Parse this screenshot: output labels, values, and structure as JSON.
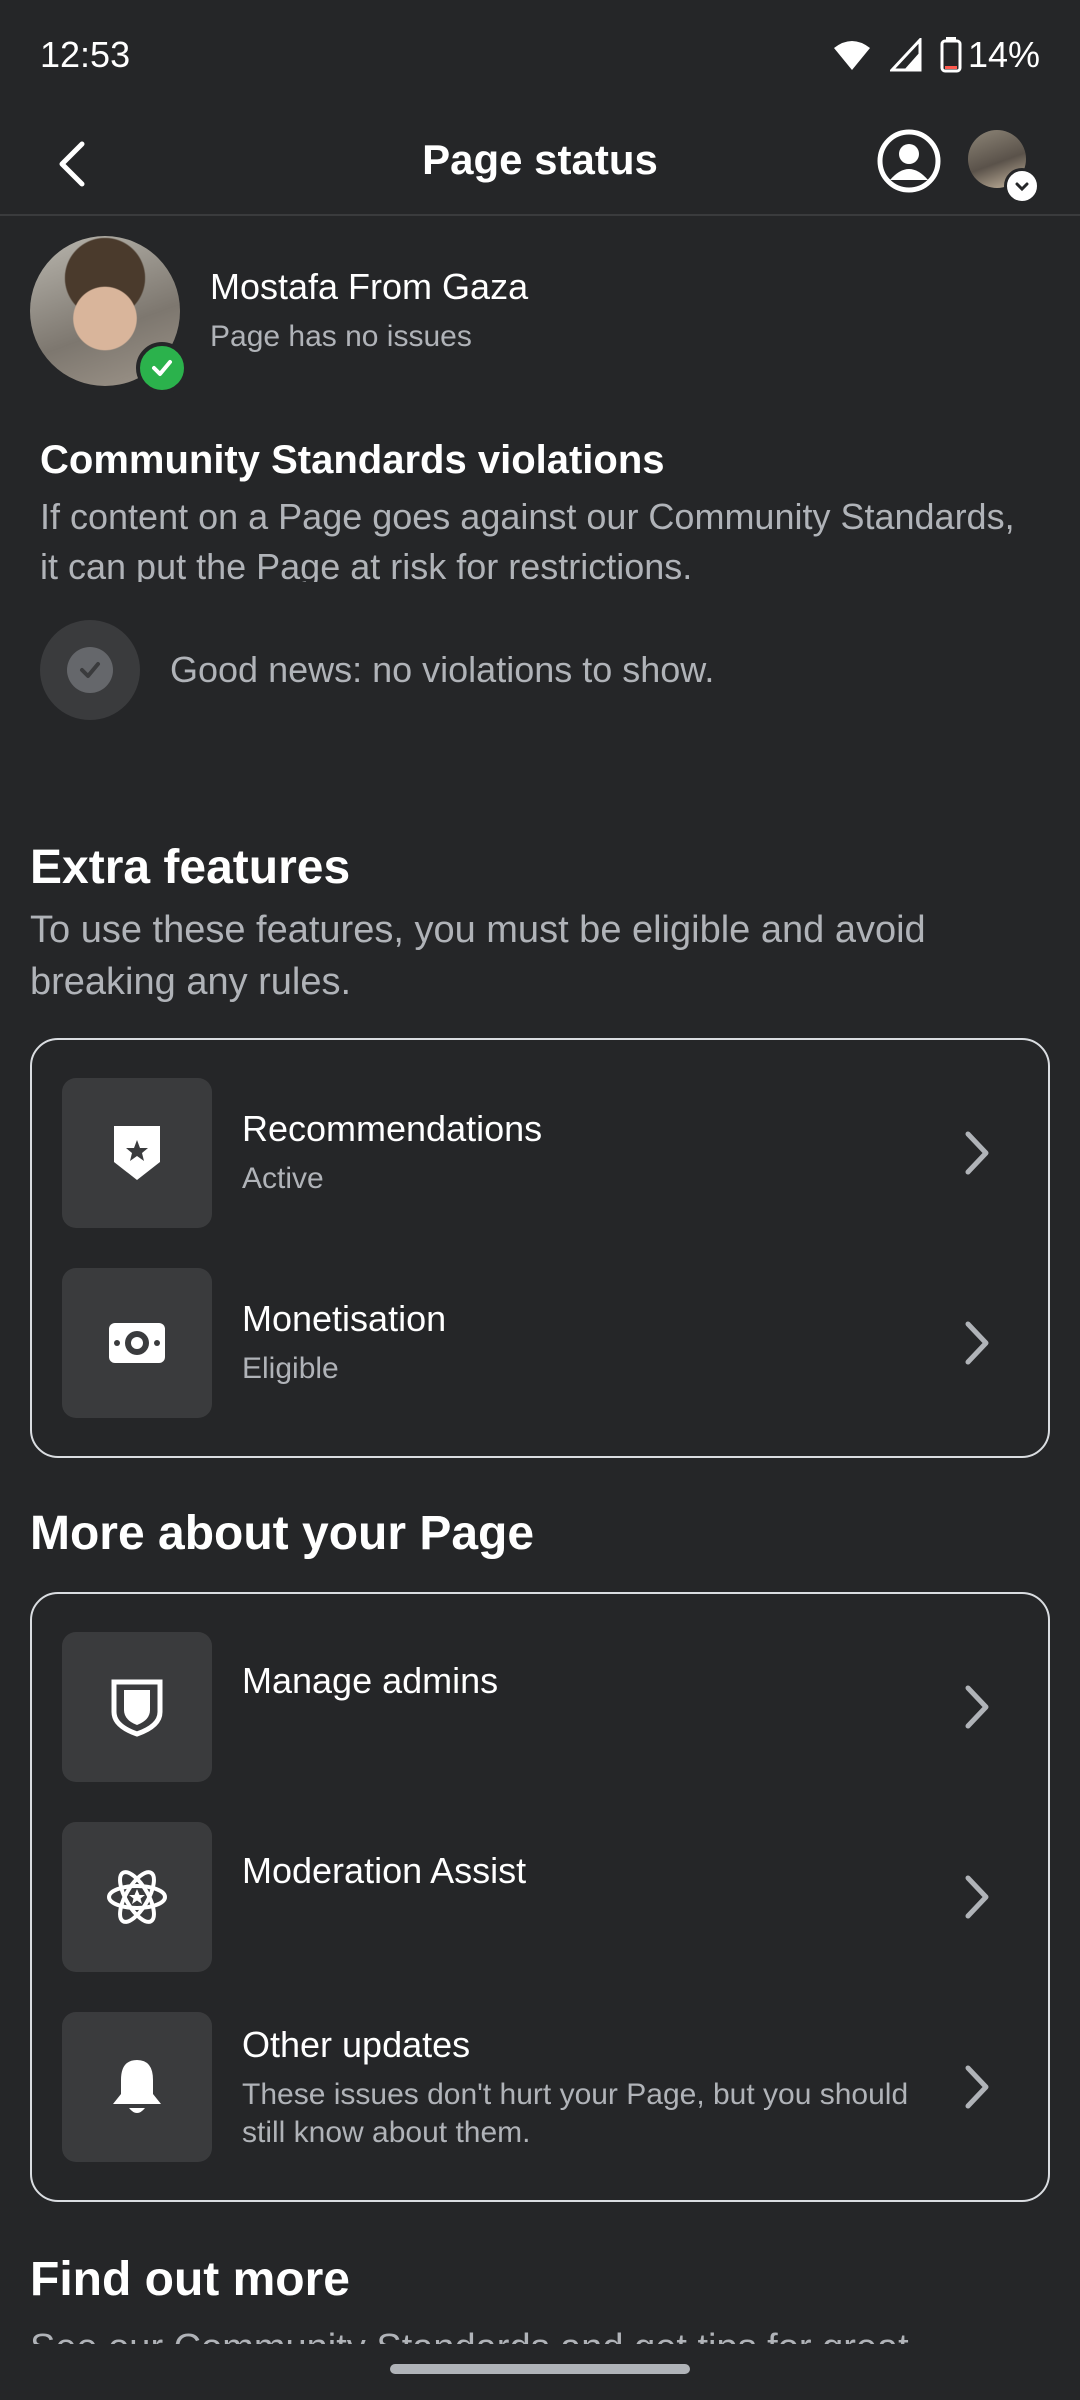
{
  "status_bar": {
    "time": "12:53",
    "battery": "14%"
  },
  "header": {
    "title": "Page status"
  },
  "page": {
    "name": "Mostafa From Gaza",
    "health": "Page has no issues"
  },
  "community_standards": {
    "title": "Community Standards violations",
    "description": "If content on a Page goes against our Community Standards, it can put the Page at risk for restrictions.",
    "empty_state": "Good news: no violations to show."
  },
  "extra_features": {
    "title": "Extra features",
    "description": "To use these features, you must be eligible and avoid breaking any rules.",
    "items": [
      {
        "title": "Recommendations",
        "subtitle": "Active",
        "icon": "shield-star-icon"
      },
      {
        "title": "Monetisation",
        "subtitle": "Eligible",
        "icon": "money-icon"
      }
    ]
  },
  "more_about": {
    "title": "More about your Page",
    "items": [
      {
        "title": "Manage admins",
        "subtitle": "",
        "icon": "shield-icon"
      },
      {
        "title": "Moderation Assist",
        "subtitle": "",
        "icon": "atom-star-icon"
      },
      {
        "title": "Other updates",
        "subtitle": "These issues don't hurt your Page, but you should still know about them.",
        "icon": "bell-icon"
      }
    ]
  },
  "find_out_more": {
    "title": "Find out more",
    "description": "See our Community Standards and get tips for great"
  },
  "colors": {
    "background": "#252628",
    "success": "#2bb24c",
    "tile": "#3a3b3d"
  }
}
